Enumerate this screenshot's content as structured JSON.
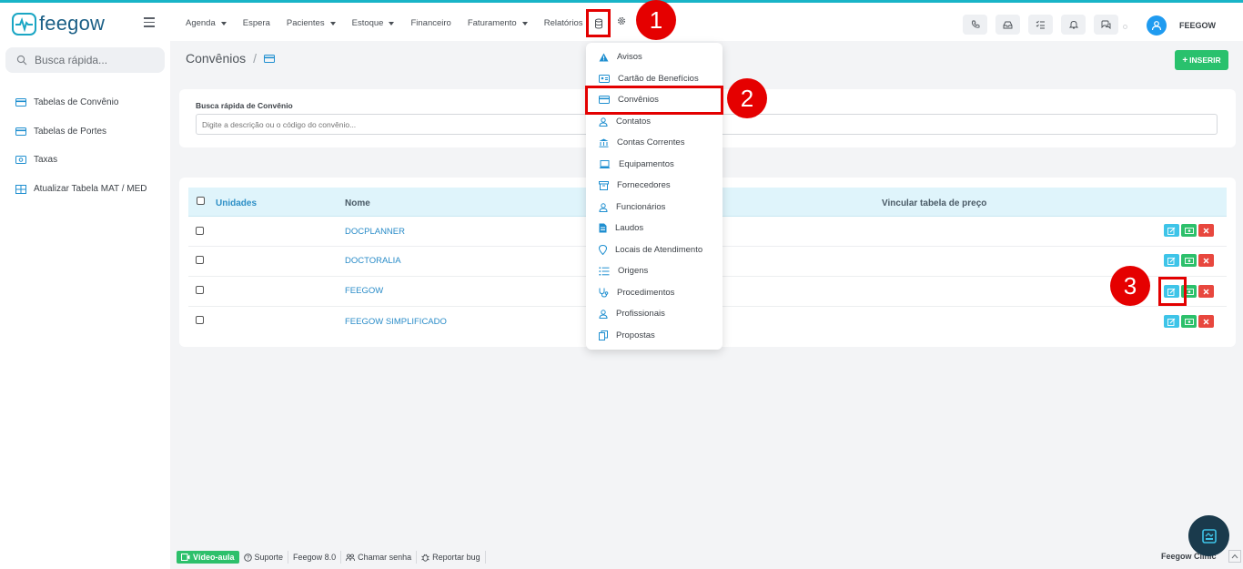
{
  "header": {
    "logo_text": "feegow",
    "nav": [
      {
        "label": "Agenda",
        "has_caret": true
      },
      {
        "label": "Espera",
        "has_caret": false
      },
      {
        "label": "Pacientes",
        "has_caret": true
      },
      {
        "label": "Estoque",
        "has_caret": true
      },
      {
        "label": "Financeiro",
        "has_caret": false
      },
      {
        "label": "Faturamento",
        "has_caret": true
      },
      {
        "label": "Relatórios",
        "has_caret": false
      }
    ],
    "user_name": "FEEGOW"
  },
  "markers": {
    "m1": "1",
    "m2": "2",
    "m3": "3"
  },
  "sidebar": {
    "search_placeholder": "Busca rápida...",
    "items": [
      {
        "label": "Tabelas de Convênio",
        "icon": "card-icon"
      },
      {
        "label": "Tabelas de Portes",
        "icon": "card-icon"
      },
      {
        "label": "Taxas",
        "icon": "money-icon"
      },
      {
        "label": "Atualizar Tabela MAT / MED",
        "icon": "grid-icon"
      }
    ]
  },
  "page": {
    "title": "Convênios",
    "breadcrumb_sep": "/",
    "insert_label": "INSERIR"
  },
  "search": {
    "label": "Busca rápida de Convênio",
    "placeholder": "Digite a descrição ou o código do convênio..."
  },
  "table": {
    "columns": {
      "unidades": "Unidades",
      "nome": "Nome",
      "vincular": "Vincular tabela de preço"
    },
    "rows": [
      {
        "nome": "DOCPLANNER"
      },
      {
        "nome": "DOCTORALIA"
      },
      {
        "nome": "FEEGOW"
      },
      {
        "nome": "FEEGOW SIMPLIFICADO"
      }
    ]
  },
  "dropdown": {
    "items": [
      {
        "label": "Avisos",
        "icon": "warning-icon"
      },
      {
        "label": "Cartão de Benefícios",
        "icon": "id-card-icon"
      },
      {
        "label": "Convênios",
        "icon": "card-icon"
      },
      {
        "label": "Contatos",
        "icon": "user-icon"
      },
      {
        "label": "Contas Correntes",
        "icon": "bank-icon"
      },
      {
        "label": "Equipamentos",
        "icon": "laptop-icon"
      },
      {
        "label": "Fornecedores",
        "icon": "box-icon"
      },
      {
        "label": "Funcionários",
        "icon": "user-icon"
      },
      {
        "label": "Laudos",
        "icon": "document-icon"
      },
      {
        "label": "Locais de Atendimento",
        "icon": "location-icon"
      },
      {
        "label": "Origens",
        "icon": "list-icon"
      },
      {
        "label": "Procedimentos",
        "icon": "stethoscope-icon"
      },
      {
        "label": "Profissionais",
        "icon": "user-icon"
      },
      {
        "label": "Propostas",
        "icon": "copy-icon"
      }
    ]
  },
  "footer": {
    "video": "Vídeo-aula",
    "suporte": "Suporte",
    "version": "Feegow 8.0",
    "chamar": "Chamar senha",
    "bug": "Reportar bug",
    "brand": "Feegow Clinic"
  },
  "colors": {
    "accent": "#1aa6c4",
    "green": "#29c16d",
    "red": "#e30000",
    "link": "#2a8cc8"
  }
}
